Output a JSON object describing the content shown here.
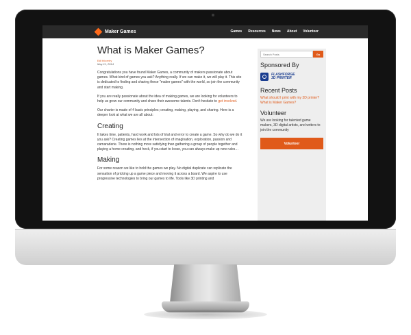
{
  "nav": {
    "brand": "Maker Games",
    "items": [
      "Games",
      "Resources",
      "News",
      "About",
      "Volunteer"
    ]
  },
  "post": {
    "title": "What is Maker Games?",
    "edit_link": "Edit this entry",
    "date": "May 11, 2014",
    "intro": "Congratulations you have found Maker Games, a community of makers passionate about games. What kind of games you ask? Anything really. If we can make it, we will play it. This site is dedicated to finding and sharing these \"maker games\" with the world, so join the community and start making.",
    "para2_text": "If you are really passionate about the idea of making games, we are looking for volunteers to help us grow our community and share their awesome talents. Don't hesitate to ",
    "para2_link": "get involved",
    "para2_end": ".",
    "para3": "Our charter is made of 4 basic principles; creating, making, playing, and sharing. Here is a deeper look at what we are all about:",
    "sections": [
      {
        "heading": "Creating",
        "text": "It takes time, patients, hard work and lots of trial and error to create a game. So why do we do it you ask? Creating games lies at the intersection of imagination, exploration, passion and camaraderie. There is nothing more satisfying than gathering a group of people together and playing a home creating, and heck,  if you start to loose, you can always make up new rules…"
      },
      {
        "heading": "Making",
        "text": "For some reason we like to hold the games we play. No digital duplicate can replicate the sensation of pricking up a game piece and moving it across a board. We aspire to use progressive technologies to bring our games to life. Tools like 3D printing and"
      }
    ]
  },
  "sidebar": {
    "search_placeholder": "Search Posts",
    "search_button": "Go",
    "sponsored_heading": "Sponsored By",
    "sponsor_line1": "FLASHFORGE",
    "sponsor_line2": "3D PRINTER",
    "recent_heading": "Recent Posts",
    "recent": [
      "What should I print with my 3D printer?",
      "What is Maker Games?"
    ],
    "volunteer_heading": "Volunteer",
    "volunteer_text": "We are looking for talented game makers, 3D digital artists, and writers to join the community",
    "volunteer_button": "Volunteer"
  },
  "colors": {
    "accent": "#e05a1a",
    "navbar": "#2a2a2a",
    "sponsor": "#1a3d8f"
  }
}
